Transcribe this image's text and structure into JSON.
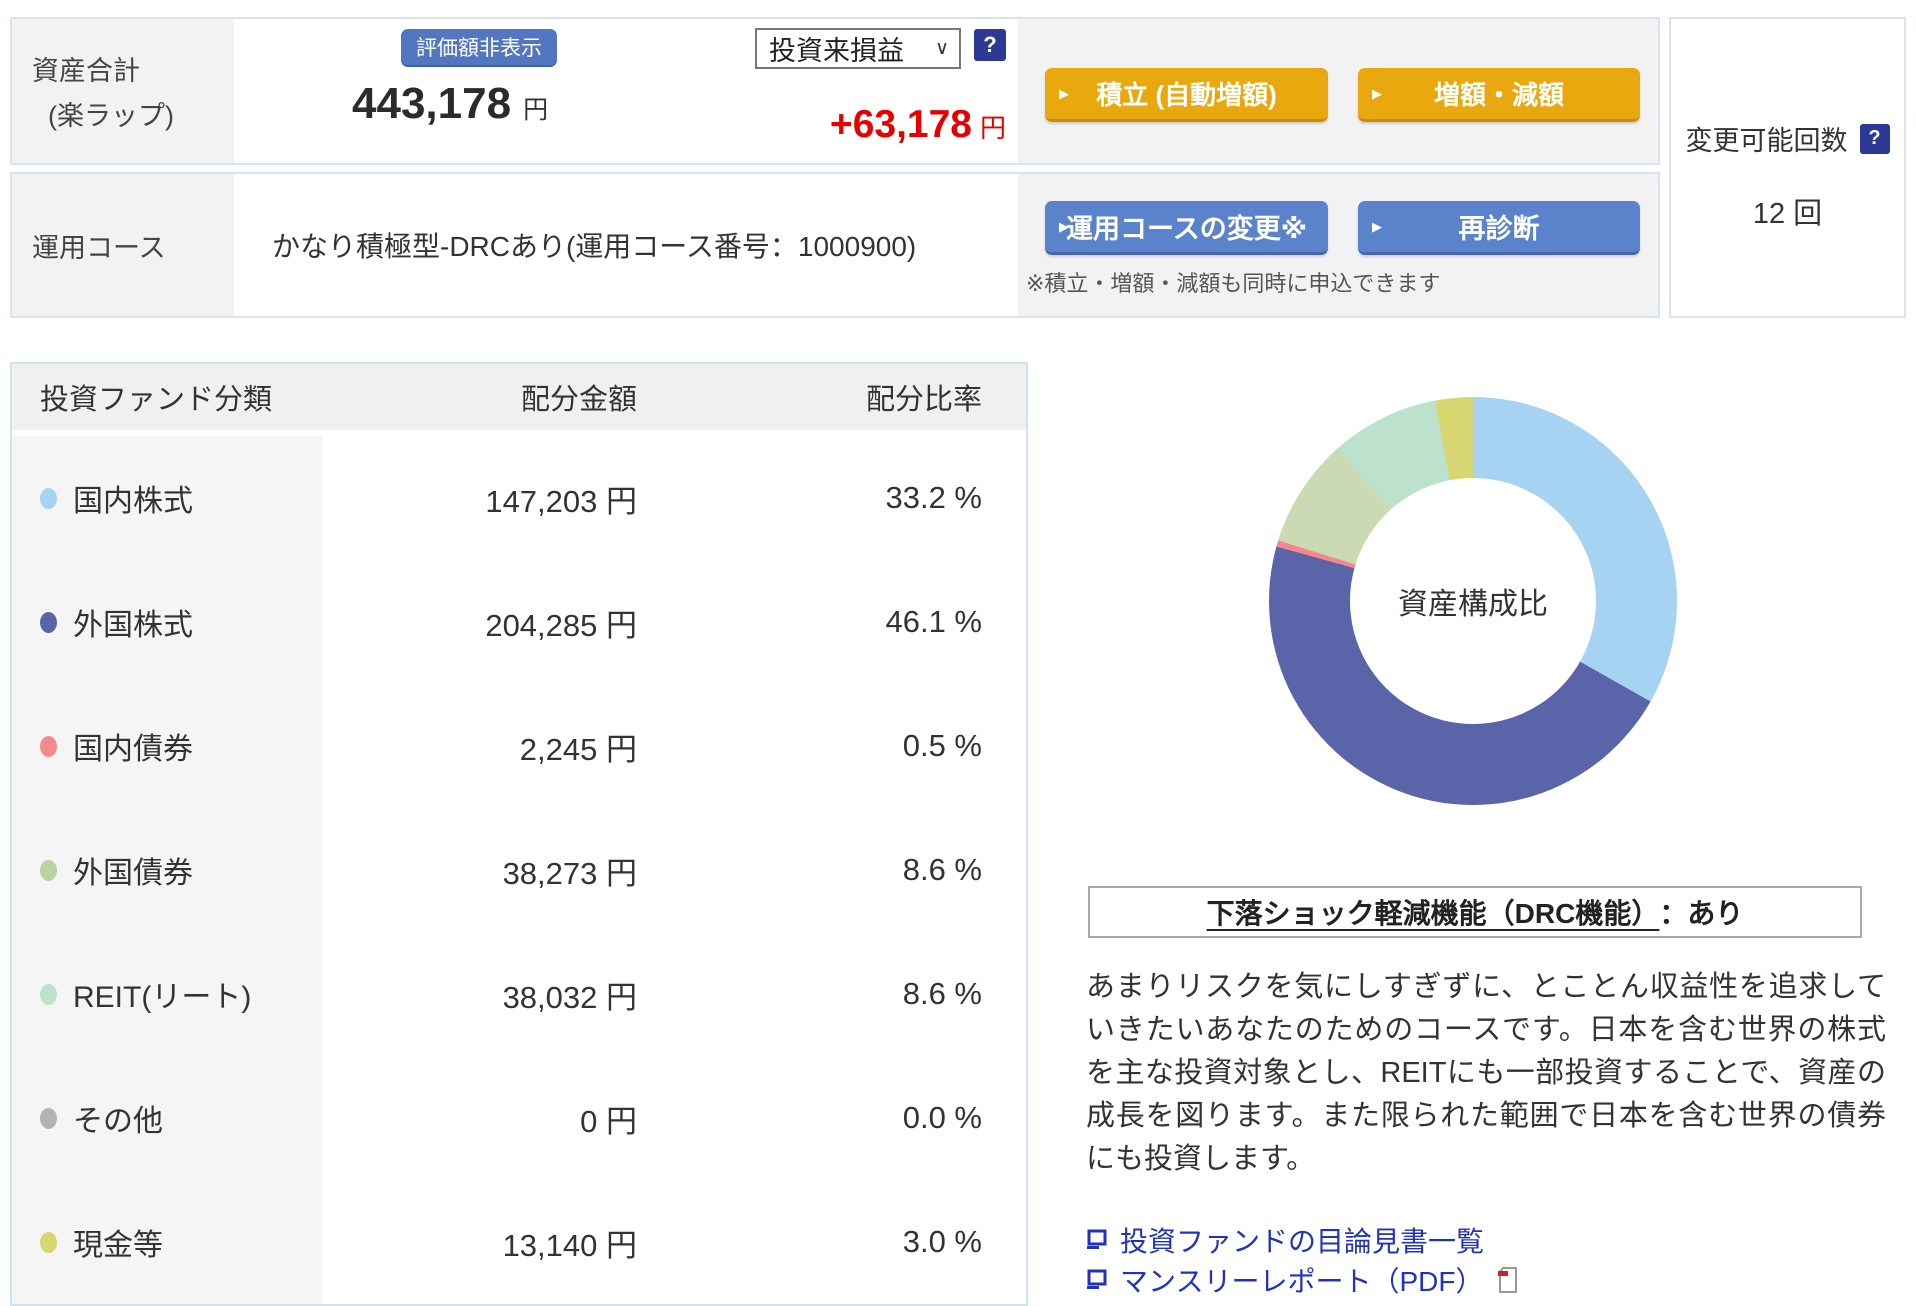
{
  "header": {
    "asset_label_line1": "資産合計",
    "asset_label_line2": "(楽ラップ)",
    "hide_valuation_button": "評価額非表示",
    "total_amount": "443,178",
    "total_unit": "円",
    "period_dropdown_value": "投資来損益",
    "help_icon": "?",
    "gain_amount": "+63,178",
    "gain_unit": "円",
    "arrow_glyph": "▶",
    "tsumitate_button": "積立 (自動増額)",
    "zougaku_button": "増額・減額",
    "course_label": "運用コース",
    "course_value": "かなり積極型-DRCあり(運用コース番号：1000900)",
    "course_change_button": "運用コースの変更※",
    "rediagnosis_button": "再診断",
    "note": "※積立・増額・減額も同時に申込できます",
    "change_panel": {
      "label": "変更可能回数",
      "value": "12 回",
      "help_icon": "?"
    }
  },
  "table": {
    "headers": [
      "投資ファンド分類",
      "配分金額",
      "配分比率"
    ],
    "rows": [
      {
        "label": "国内株式",
        "amount": "147,203 円",
        "ratio": "33.2 %",
        "color": "#a6d3f2"
      },
      {
        "label": "外国株式",
        "amount": "204,285 円",
        "ratio": "46.1 %",
        "color": "#5a64a8"
      },
      {
        "label": "国内債券",
        "amount": "2,245 円",
        "ratio": "0.5 %",
        "color": "#f5888d"
      },
      {
        "label": "外国債券",
        "amount": "38,273 円",
        "ratio": "8.6 %",
        "color": "#b9d2a0"
      },
      {
        "label": "REIT(リート)",
        "amount": "38,032 円",
        "ratio": "8.6 %",
        "color": "#bce2cd"
      },
      {
        "label": "その他",
        "amount": "0 円",
        "ratio": "0.0 %",
        "color": "#b3b3b3"
      },
      {
        "label": "現金等",
        "amount": "13,140 円",
        "ratio": "3.0 %",
        "color": "#d8d671"
      }
    ]
  },
  "chart_data": {
    "type": "pie",
    "donut": true,
    "center_label": "資産構成比",
    "categories": [
      "国内株式",
      "外国株式",
      "国内債券",
      "外国債券",
      "REIT(リート)",
      "その他",
      "現金等"
    ],
    "values": [
      33.2,
      46.1,
      0.5,
      8.6,
      8.6,
      0.0,
      3.0
    ],
    "colors": [
      "#a6d3f2",
      "#5a64a8",
      "#f5888d",
      "#ccdab3",
      "#bce2cd",
      "#b3b3b3",
      "#d8d671"
    ],
    "start_angle_deg": 0,
    "direction": "clockwise",
    "legend_position": "table-left"
  },
  "drc_box": {
    "underlined": "下落ショック軽減機能（DRC機能）",
    "suffix": "：あり"
  },
  "description": "あまりリスクを気にしすぎずに、とことん収益性を追求していきたいあなたのためのコースです。日本を含む世界の株式を主な投資対象とし、REITにも一部投資することで、資産の成長を図ります。また限られた範囲で日本を含む世界の債券にも投資します。",
  "links": [
    {
      "label": "投資ファンドの目論見書一覧"
    },
    {
      "label": "マンスリーレポート（PDF）"
    }
  ]
}
